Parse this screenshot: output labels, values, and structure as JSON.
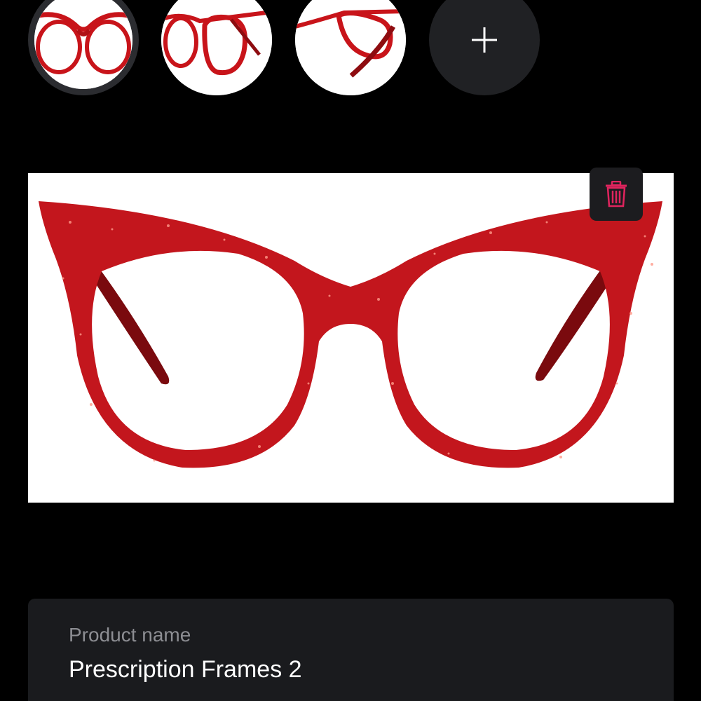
{
  "thumbnails": [
    {
      "view": "front",
      "selected": true
    },
    {
      "view": "angle",
      "selected": false
    },
    {
      "view": "side",
      "selected": false
    }
  ],
  "add_photo": {
    "icon": "plus-icon"
  },
  "main_image": {
    "subject": "red glitter cat-eye eyeglass frames"
  },
  "delete_photo": {
    "icon": "trash-icon",
    "color": "#e0245e"
  },
  "product_name": {
    "label": "Product name",
    "value": "Prescription Frames 2"
  },
  "colors": {
    "background": "#000000",
    "card": "#1a1b1e",
    "frame_red": "#c0161c",
    "accent_pink": "#e0245e"
  }
}
